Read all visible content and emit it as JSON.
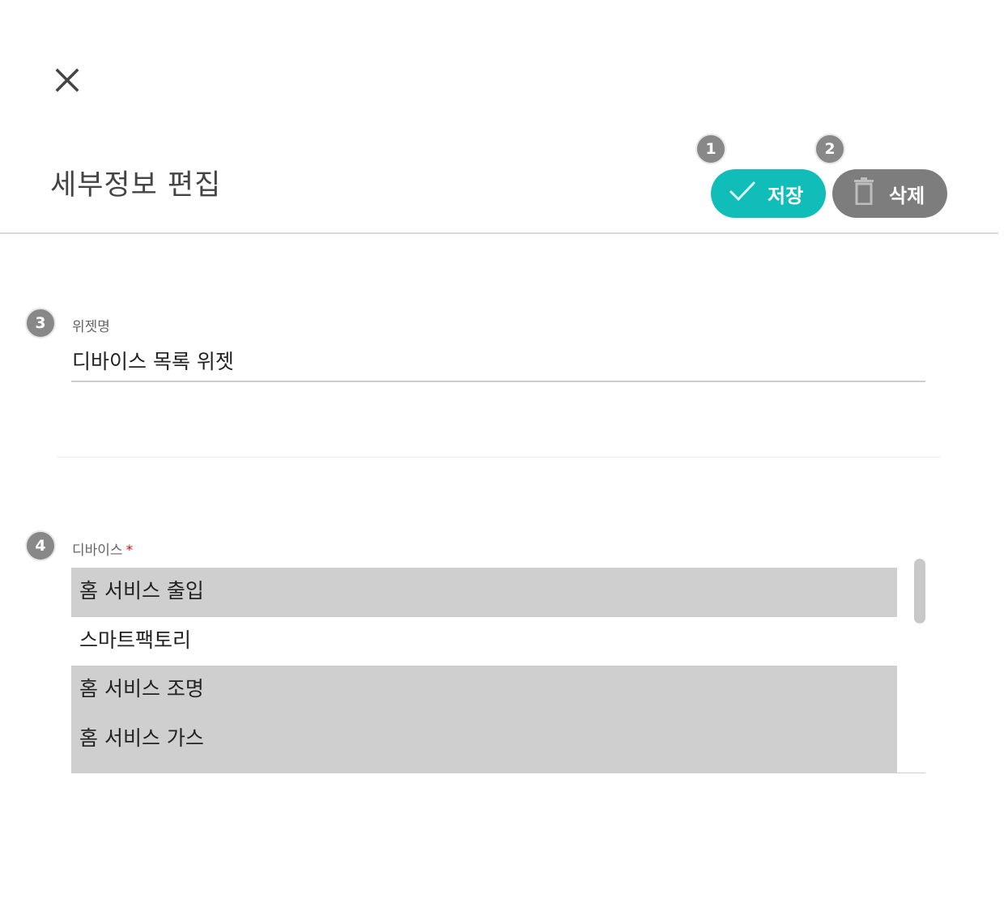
{
  "header": {
    "title": "세부정보 편집",
    "close_icon": "close-icon",
    "save_label": "저장",
    "save_icon": "check-icon",
    "delete_label": "삭제",
    "delete_icon": "trash-icon",
    "badges": {
      "save": "1",
      "delete": "2"
    },
    "colors": {
      "save": "#11bdb9",
      "delete": "#7d7d7d"
    }
  },
  "widget_name": {
    "badge": "3",
    "label": "위젯명",
    "value": "디바이스 목록 위젯"
  },
  "devices": {
    "badge": "4",
    "label": "디바이스",
    "required_mark": "*",
    "items": [
      {
        "label": "홈 서비스 출입",
        "selected": true
      },
      {
        "label": "스마트팩토리",
        "selected": false
      },
      {
        "label": "홈 서비스 조명",
        "selected": true
      },
      {
        "label": "홈 서비스 가스",
        "selected": true
      }
    ]
  }
}
